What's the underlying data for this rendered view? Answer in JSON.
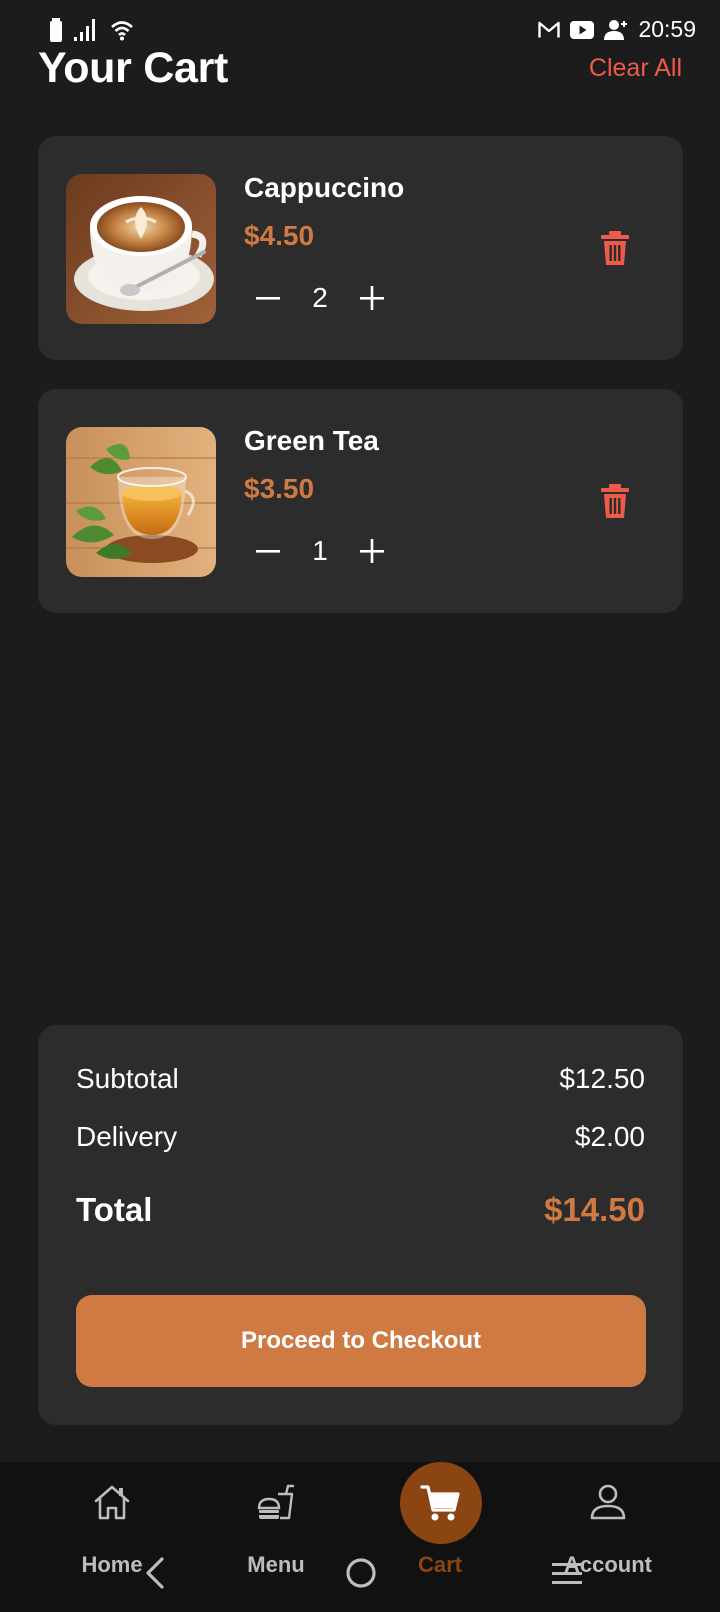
{
  "status_bar": {
    "time": "20:59",
    "icons": [
      "battery-icon",
      "signal-icon",
      "wifi-icon",
      "gmail-icon",
      "youtube-icon",
      "person-add-icon"
    ]
  },
  "header": {
    "title": "Your Cart",
    "clear_all_label": "Clear All"
  },
  "cart": {
    "items": [
      {
        "name": "Cappuccino",
        "price": "$4.50",
        "quantity": "2",
        "image": "cappuccino-cup-image"
      },
      {
        "name": "Green Tea",
        "price": "$3.50",
        "quantity": "1",
        "image": "green-tea-cup-image"
      }
    ]
  },
  "summary": {
    "subtotal_label": "Subtotal",
    "subtotal_value": "$12.50",
    "delivery_label": "Delivery",
    "delivery_value": "$2.00",
    "total_label": "Total",
    "total_value": "$14.50",
    "checkout_label": "Proceed to Checkout"
  },
  "nav": {
    "items": [
      {
        "label": "Home",
        "icon": "home-icon"
      },
      {
        "label": "Menu",
        "icon": "fastfood-icon"
      },
      {
        "label": "Cart",
        "icon": "cart-icon",
        "active": true
      },
      {
        "label": "Account",
        "icon": "person-icon"
      }
    ]
  },
  "colors": {
    "background": "#1c1c1c",
    "card": "#2c2c2c",
    "accent": "#cf7a43",
    "danger": "#f05a4a",
    "active_nav": "#8b4513"
  }
}
